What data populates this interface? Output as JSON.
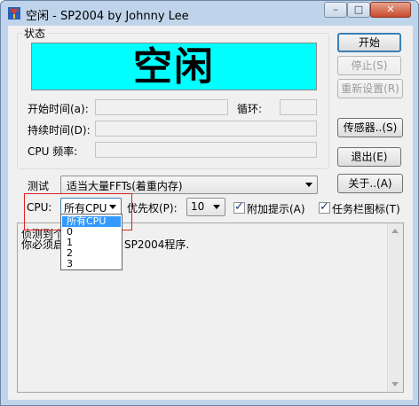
{
  "window": {
    "title": "空闲 - SP2004 by Johnny Lee",
    "icon": "sp2004-app-icon"
  },
  "titlebar": {
    "minimize_glyph": "–",
    "maximize_glyph": "□",
    "close_glyph": "✕"
  },
  "status": {
    "group_label": "状态",
    "state_text": "空闲",
    "state_bg": "#00ffff"
  },
  "fields": {
    "start_time_label": "开始时间(a):",
    "loop_label": "循环:",
    "duration_label": "持续时间(D):",
    "cpu_freq_label": "CPU 频率:"
  },
  "buttons": {
    "start": "开始",
    "stop": "停止(S)",
    "reset": "重新设置(R)",
    "sensors": "传感器..(S)",
    "exit": "退出(E)",
    "about": "关于..(A)"
  },
  "test": {
    "label": "测试",
    "selected": "适当大量FFTs(着重内存)"
  },
  "cpu": {
    "label": "CPU:",
    "selected": "所有CPU",
    "options": [
      "所有CPU",
      "0",
      "1",
      "2",
      "3"
    ]
  },
  "priority": {
    "label": "优先权(P):",
    "selected": "10"
  },
  "checkboxes": {
    "extra_hints": {
      "label": "附加提示(A)",
      "checked": true
    },
    "tray_icon": {
      "label": "任务栏图标(T)",
      "checked": true
    }
  },
  "log": {
    "line1": "侦测到个",
    "line2_a": "你必须启",
    "line2_b": "SP2004程序."
  }
}
